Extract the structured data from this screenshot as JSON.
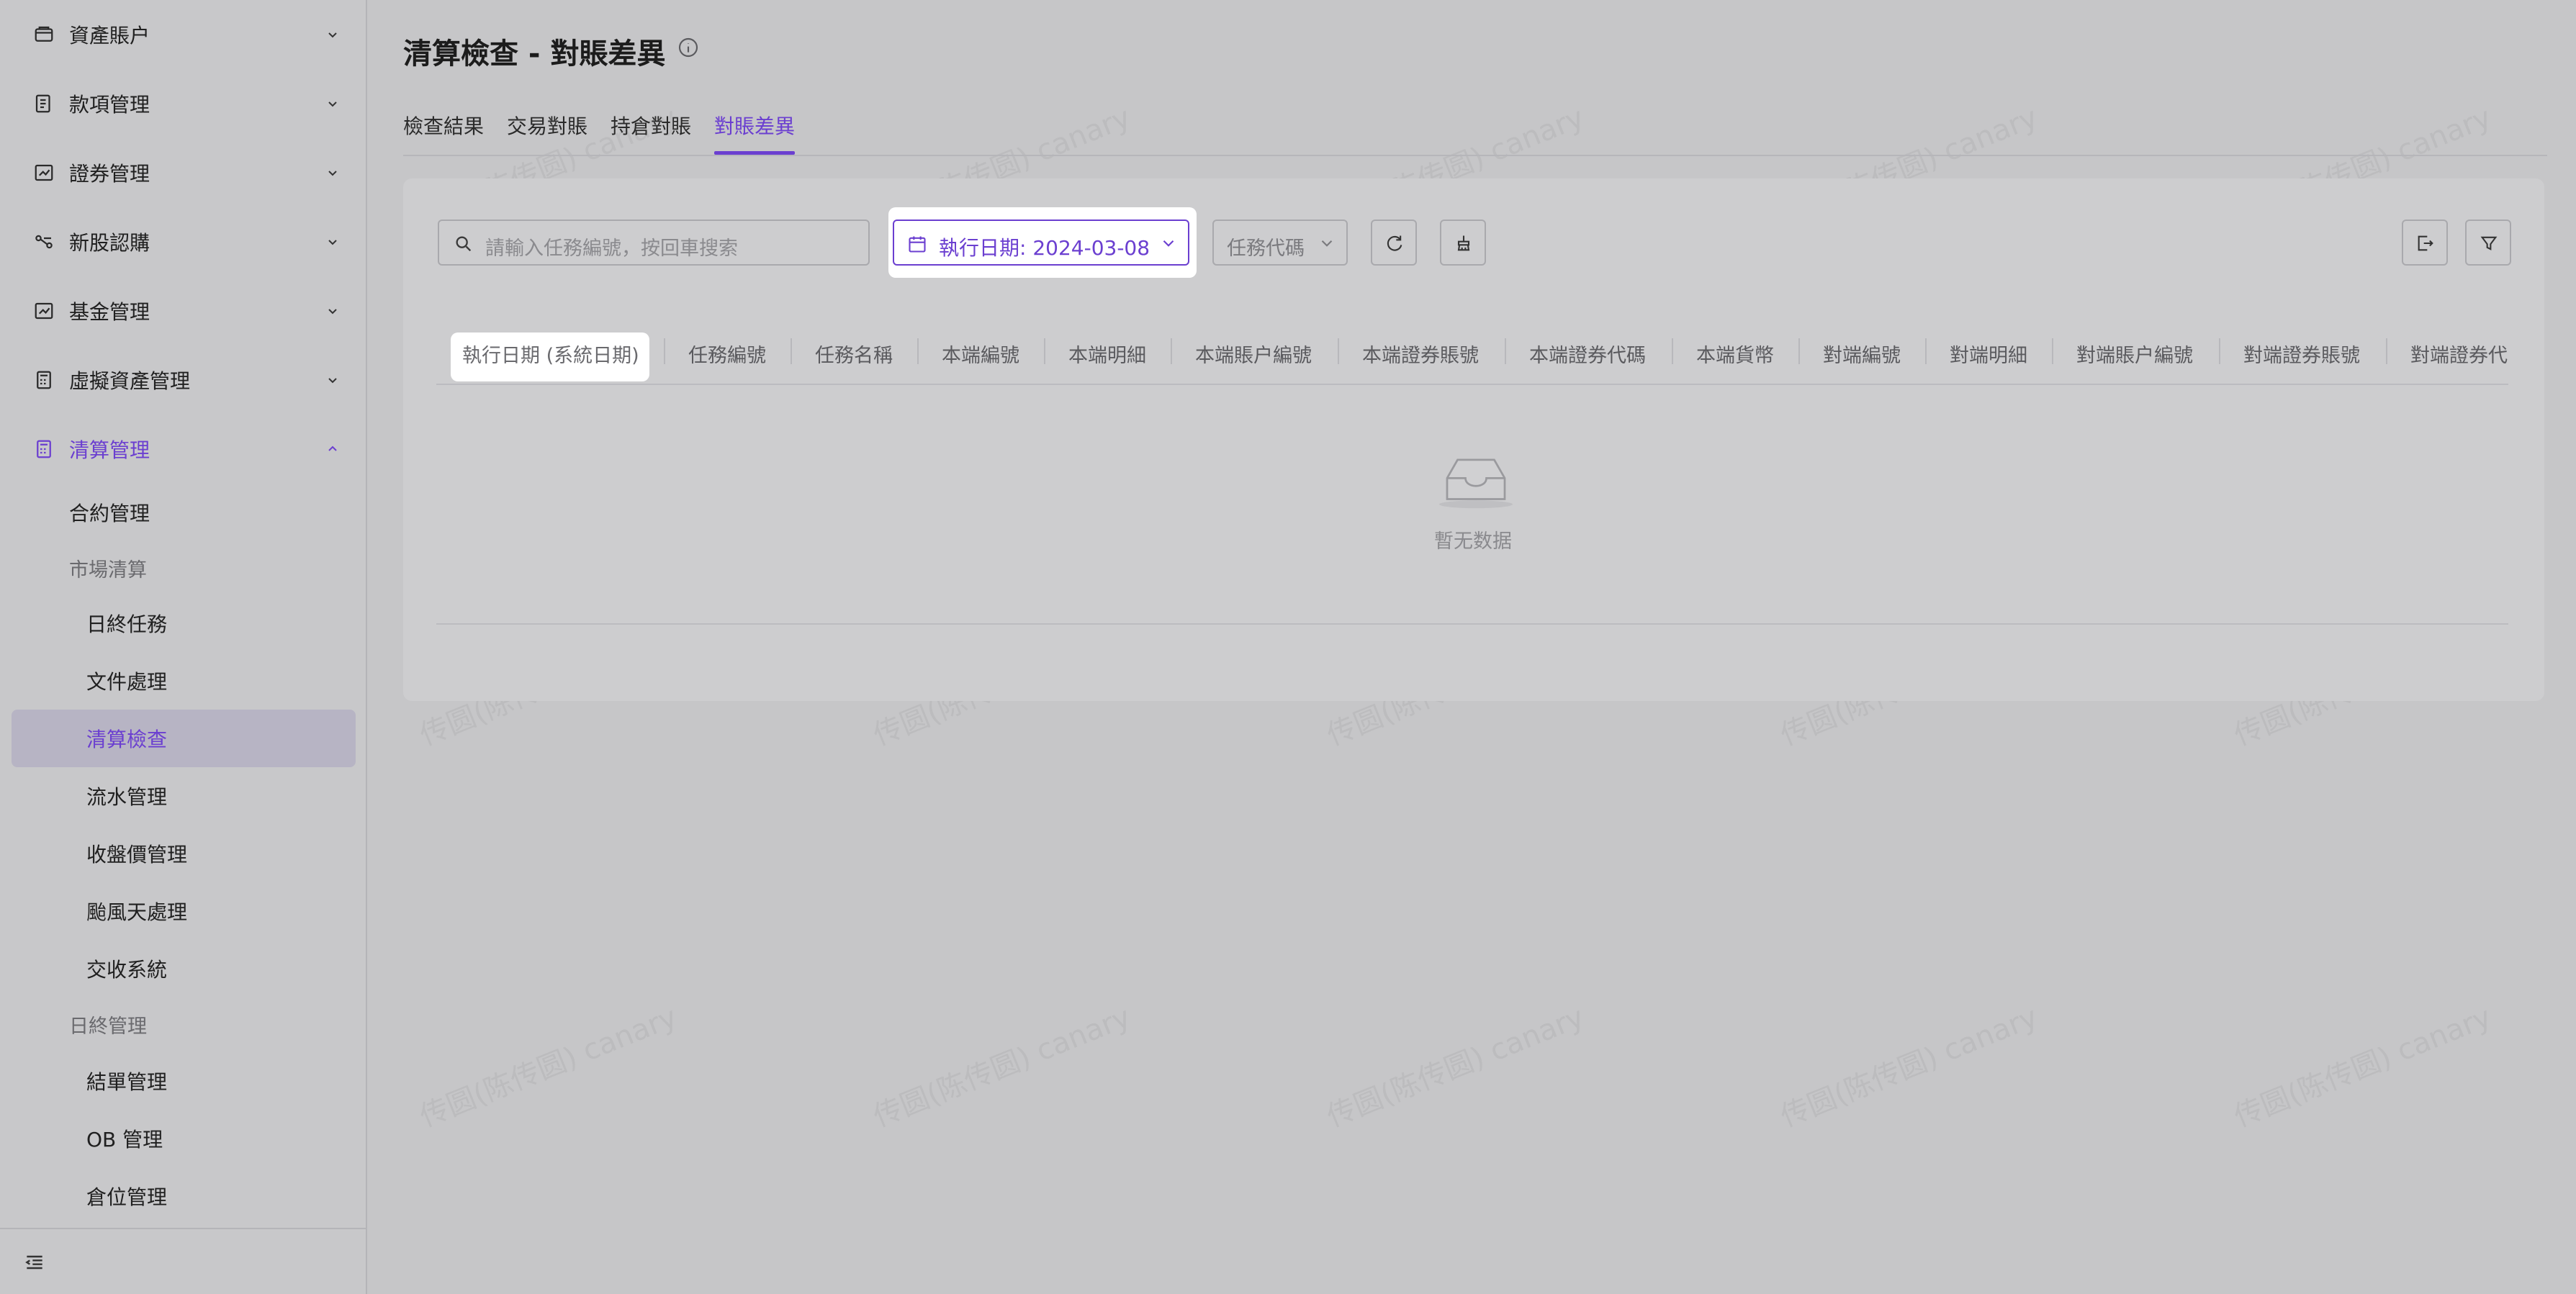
{
  "sidebar": {
    "groups": [
      {
        "label": "資產賬户",
        "icon": "wallet-icon"
      },
      {
        "label": "款項管理",
        "icon": "document-list-icon"
      },
      {
        "label": "證券管理",
        "icon": "chart-box-icon"
      },
      {
        "label": "新股認購",
        "icon": "link-icon"
      },
      {
        "label": "基金管理",
        "icon": "chart-box-icon"
      },
      {
        "label": "虛擬資產管理",
        "icon": "calculator-icon"
      },
      {
        "label": "清算管理",
        "icon": "calculator-icon"
      }
    ],
    "sub_items": {
      "contract": "合約管理",
      "market_section": "市場清算",
      "eod_tasks": "日終任務",
      "file_processing": "文件處理",
      "clearing_check": "清算檢查",
      "flow_management": "流水管理",
      "closing_price": "收盤價管理",
      "typhoon": "颱風天處理",
      "settlement_system": "交收系統",
      "eod_section": "日終管理",
      "statement": "結單管理",
      "ob": "OB 管理",
      "position": "倉位管理"
    }
  },
  "page": {
    "title": "清算檢查 - 對賬差異"
  },
  "tabs": [
    "檢查結果",
    "交易對賬",
    "持倉對賬",
    "對賬差異"
  ],
  "toolbar": {
    "search_placeholder": "請輸入任務編號，按回車搜索",
    "date_label": "執行日期: 2024-03-08",
    "task_code_placeholder": "任務代碼"
  },
  "table": {
    "columns": [
      "執行日期 (系統日期)",
      "任務編號",
      "任務名稱",
      "本端編號",
      "本端明細",
      "本端賬户編號",
      "本端證券賬號",
      "本端證券代碼",
      "本端貨幣",
      "對端編號",
      "對端明細",
      "對端賬户編號",
      "對端證券賬號",
      "對端證券代"
    ],
    "empty_text": "暫无数据"
  },
  "watermark": "传圆(陈传圆) canary",
  "colors": {
    "accent": "#6b3fd0",
    "overlay": "#c6c6c8"
  }
}
